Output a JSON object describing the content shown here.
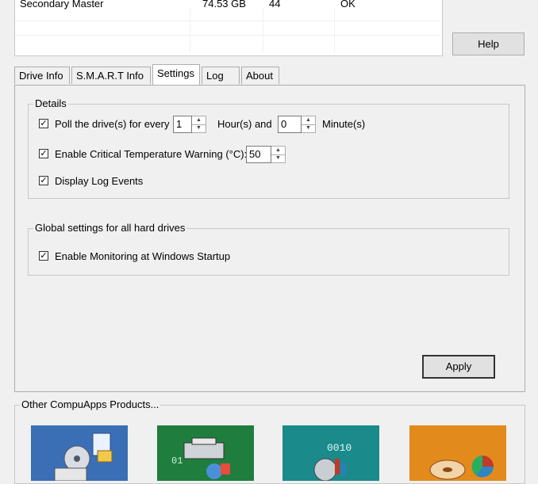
{
  "drive_list": {
    "row": {
      "name": "Secondary Master",
      "size": "74.53 GB",
      "temp": "44",
      "status": "OK"
    }
  },
  "help_label": "Help",
  "tabs": [
    {
      "label": "Drive Info",
      "active": false
    },
    {
      "label": "S.M.A.R.T Info",
      "active": false
    },
    {
      "label": "Settings",
      "active": true
    },
    {
      "label": "Log",
      "active": false
    },
    {
      "label": "About",
      "active": false
    }
  ],
  "details": {
    "title": "Details",
    "poll_prefix": "Poll the drive(s) for every",
    "poll_hours": "1",
    "poll_hours_label": "Hour(s) and",
    "poll_minutes": "0",
    "poll_minutes_label": "Minute(s)",
    "critical_temp_label": "Enable Critical Temperature Warning (°C):",
    "critical_temp_value": "50",
    "log_events_label": "Display Log Events",
    "poll_checked": true,
    "critical_temp_checked": true,
    "log_events_checked": true
  },
  "global": {
    "title": "Global settings for all hard drives",
    "startup_label": "Enable Monitoring at Windows Startup",
    "startup_checked": true
  },
  "apply_label": "Apply",
  "products": {
    "title": "Other CompuApps Products...",
    "items": [
      {
        "icon": "drive-backup-icon",
        "color": "#3a6fb5"
      },
      {
        "icon": "data-recovery-icon",
        "color": "#1f7d3e"
      },
      {
        "icon": "binary-disk-icon",
        "color": "#1a8a8a"
      },
      {
        "icon": "disk-pie-icon",
        "color": "#e38a1c"
      }
    ]
  },
  "colors": {
    "window_bg": "#f0f0f0",
    "panel_border": "#adadad"
  }
}
